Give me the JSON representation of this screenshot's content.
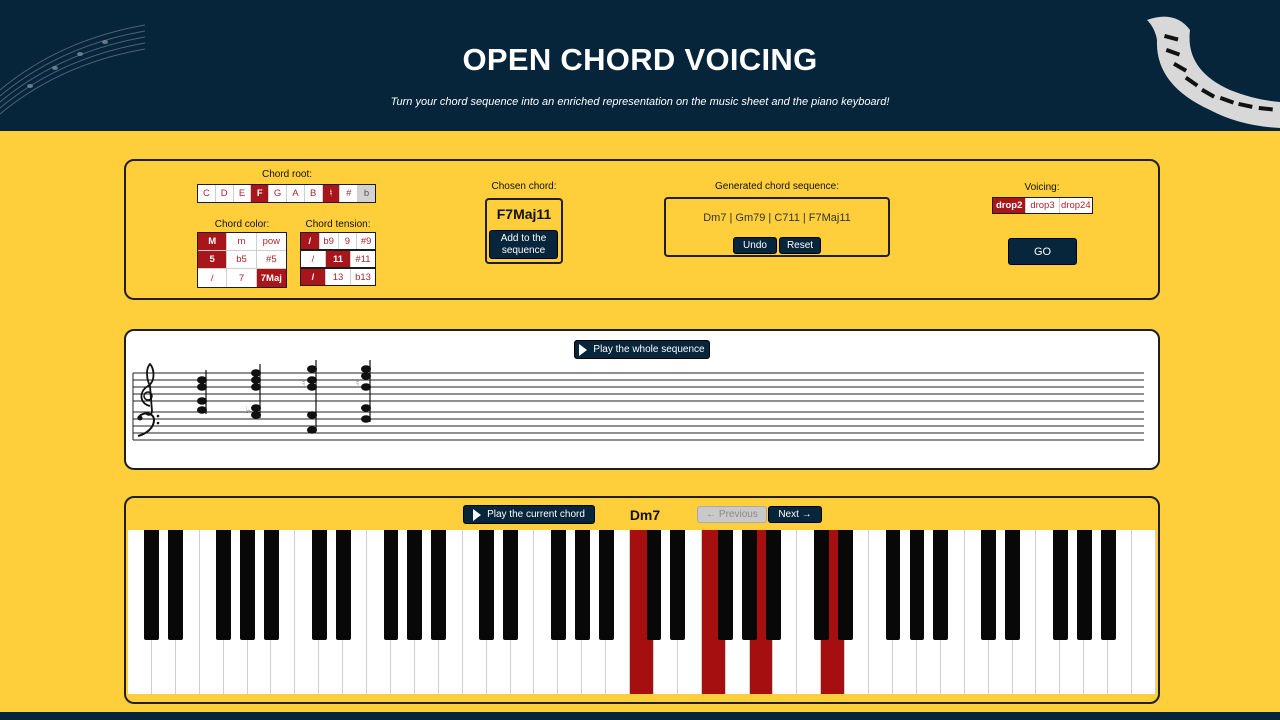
{
  "header": {
    "title": "OPEN CHORD VOICING",
    "subtitle": "Turn your chord sequence into an enriched representation on the music sheet and the piano keyboard!"
  },
  "builder": {
    "root_label": "Chord root:",
    "roots": [
      "C",
      "D",
      "E",
      "F",
      "G",
      "A",
      "B",
      "♮",
      "#",
      "b"
    ],
    "root_selected": [
      "F",
      "♮"
    ],
    "color_label": "Chord color:",
    "color_rows": [
      [
        "M",
        "m",
        "pow"
      ],
      [
        "5",
        "b5",
        "#5"
      ],
      [
        "/",
        "7",
        "7Maj"
      ]
    ],
    "color_selected": [
      "M",
      "5",
      "7Maj"
    ],
    "tension_label": "Chord tension:",
    "tension_rows": [
      [
        "/",
        "b9",
        "9",
        "#9"
      ],
      [
        "/",
        "11",
        "#11"
      ],
      [
        "/",
        "13",
        "b13"
      ]
    ],
    "tension_selected": [
      "/",
      "11",
      "/"
    ],
    "chosen_label": "Chosen chord:",
    "chosen_chord": "F7Maj11",
    "add_button": "Add to the sequence",
    "sequence_label": "Generated chord sequence:",
    "sequence_text": "Dm7 | Gm79 | C711 | F7Maj11",
    "undo_button": "Undo",
    "reset_button": "Reset",
    "voicing_label": "Voicing:",
    "voicings": [
      "drop2",
      "drop3",
      "drop24"
    ],
    "voicing_selected": "drop2",
    "go_button": "GO"
  },
  "score": {
    "play_sequence_button": "Play the whole sequence"
  },
  "keyboard": {
    "play_chord_button": "Play the current chord",
    "current_chord": "Dm7",
    "previous_button": "← Previous",
    "next_button": "Next →",
    "octaves": 6,
    "highlighted_notes": [
      "C4",
      "F4",
      "A4",
      "D5"
    ]
  },
  "colors": {
    "header_bg": "#06243a",
    "page_bg": "#fecf3a",
    "accent_red": "#a8161c",
    "button_dark": "#07253b"
  }
}
